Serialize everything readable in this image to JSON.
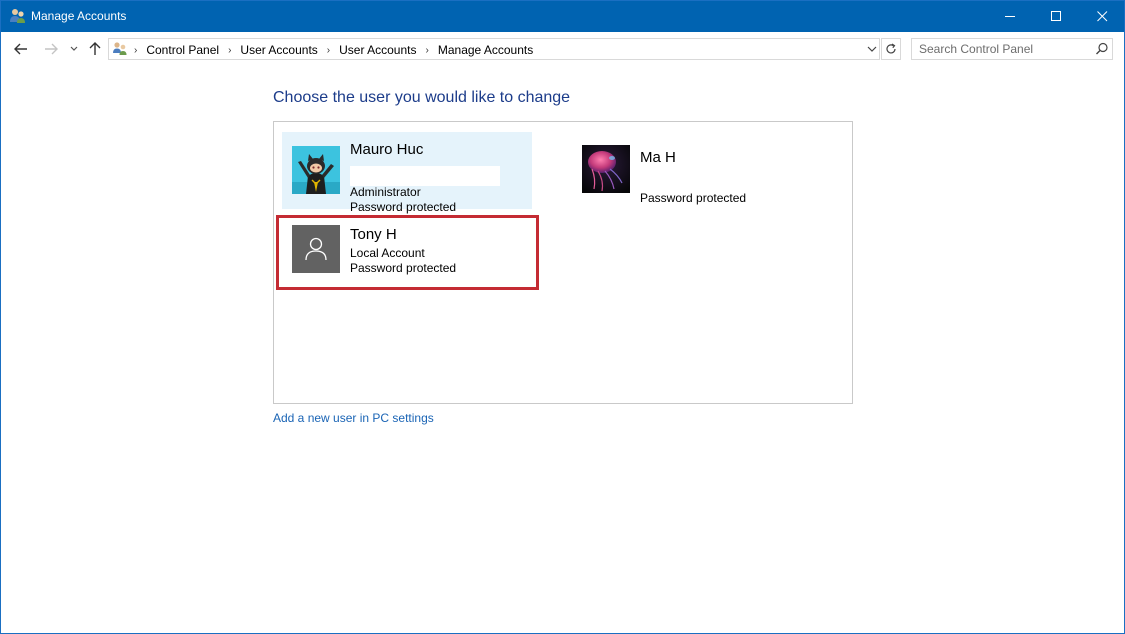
{
  "window": {
    "title": "Manage Accounts"
  },
  "nav": {
    "breadcrumbs": [
      "Control Panel",
      "User Accounts",
      "User Accounts",
      "Manage Accounts"
    ]
  },
  "search": {
    "placeholder": "Search Control Panel"
  },
  "main": {
    "heading": "Choose the user you would like to change",
    "accounts": [
      {
        "name": "Mauro Huc",
        "line1": "Administrator",
        "line2": "Password protected",
        "selected": true
      },
      {
        "name": "Ma H",
        "line1": "Password protected"
      },
      {
        "name": "Tony H",
        "line1": "Local Account",
        "line2": "Password protected",
        "highlighted": true
      }
    ],
    "add_user_link": "Add a new user in PC settings"
  },
  "colors": {
    "titlebar": "#0063b1",
    "heading": "#1c3c8a",
    "link": "#1a64b5",
    "highlight_border": "#c42b33",
    "selected_bg": "#e5f3fb"
  }
}
